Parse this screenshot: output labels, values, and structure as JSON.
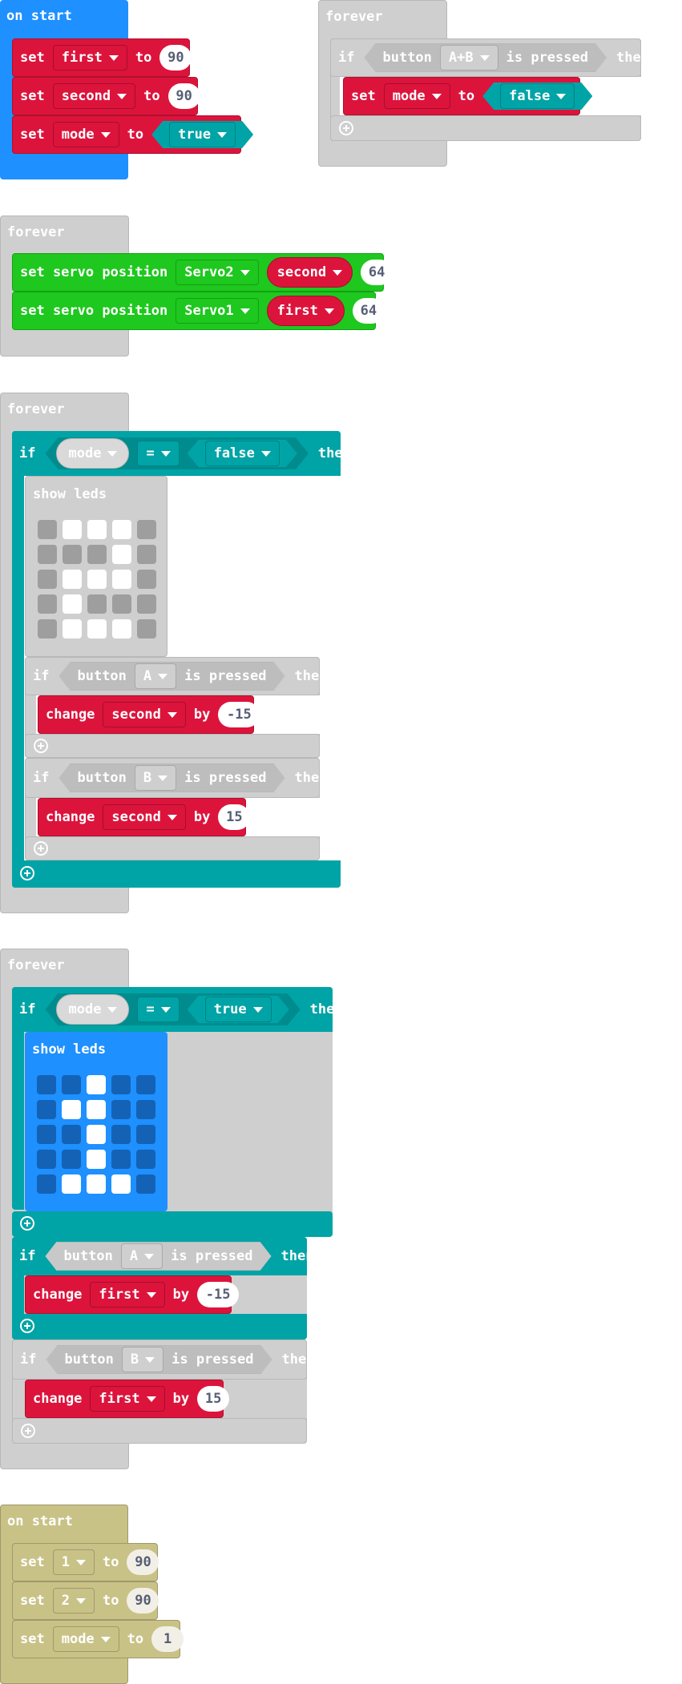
{
  "labels": {
    "on_start": "on start",
    "forever": "forever",
    "set": "set",
    "to": "to",
    "if": "if",
    "then": "then",
    "button": "button",
    "is_pressed": "is pressed",
    "show_leds": "show leds",
    "change": "change",
    "by": "by",
    "set_servo_position": "set servo position",
    "eq": "="
  },
  "block1": {
    "rows": [
      {
        "var": "first",
        "value": "90"
      },
      {
        "var": "second",
        "value": "90"
      },
      {
        "var": "mode",
        "value": "true"
      }
    ]
  },
  "block2": {
    "button": "A+B",
    "var": "mode",
    "value": "false"
  },
  "block3": {
    "rows": [
      {
        "servo": "Servo2",
        "var": "second",
        "num": "64"
      },
      {
        "servo": "Servo1",
        "var": "first",
        "num": "64"
      }
    ]
  },
  "block4": {
    "cond_var": "mode",
    "cond_op": "=",
    "cond_val": "false",
    "leds": [
      [
        0,
        1,
        1,
        1,
        0
      ],
      [
        0,
        0,
        0,
        1,
        0
      ],
      [
        0,
        1,
        1,
        1,
        0
      ],
      [
        0,
        1,
        0,
        0,
        0
      ],
      [
        0,
        1,
        1,
        1,
        0
      ]
    ],
    "if1": {
      "button": "A",
      "var": "second",
      "value": "-15"
    },
    "if2": {
      "button": "B",
      "var": "second",
      "value": "15"
    }
  },
  "block5": {
    "cond_var": "mode",
    "cond_op": "=",
    "cond_val": "true",
    "leds": [
      [
        0,
        0,
        1,
        0,
        0
      ],
      [
        0,
        1,
        1,
        0,
        0
      ],
      [
        0,
        0,
        1,
        0,
        0
      ],
      [
        0,
        0,
        1,
        0,
        0
      ],
      [
        0,
        1,
        1,
        1,
        0
      ]
    ],
    "if1": {
      "button": "A",
      "var": "first",
      "value": "-15"
    },
    "if2": {
      "button": "B",
      "var": "first",
      "value": "15"
    }
  },
  "block6": {
    "rows": [
      {
        "var": "1",
        "value": "90"
      },
      {
        "var": "2",
        "value": "90"
      },
      {
        "var": "mode",
        "value": "1"
      }
    ]
  }
}
